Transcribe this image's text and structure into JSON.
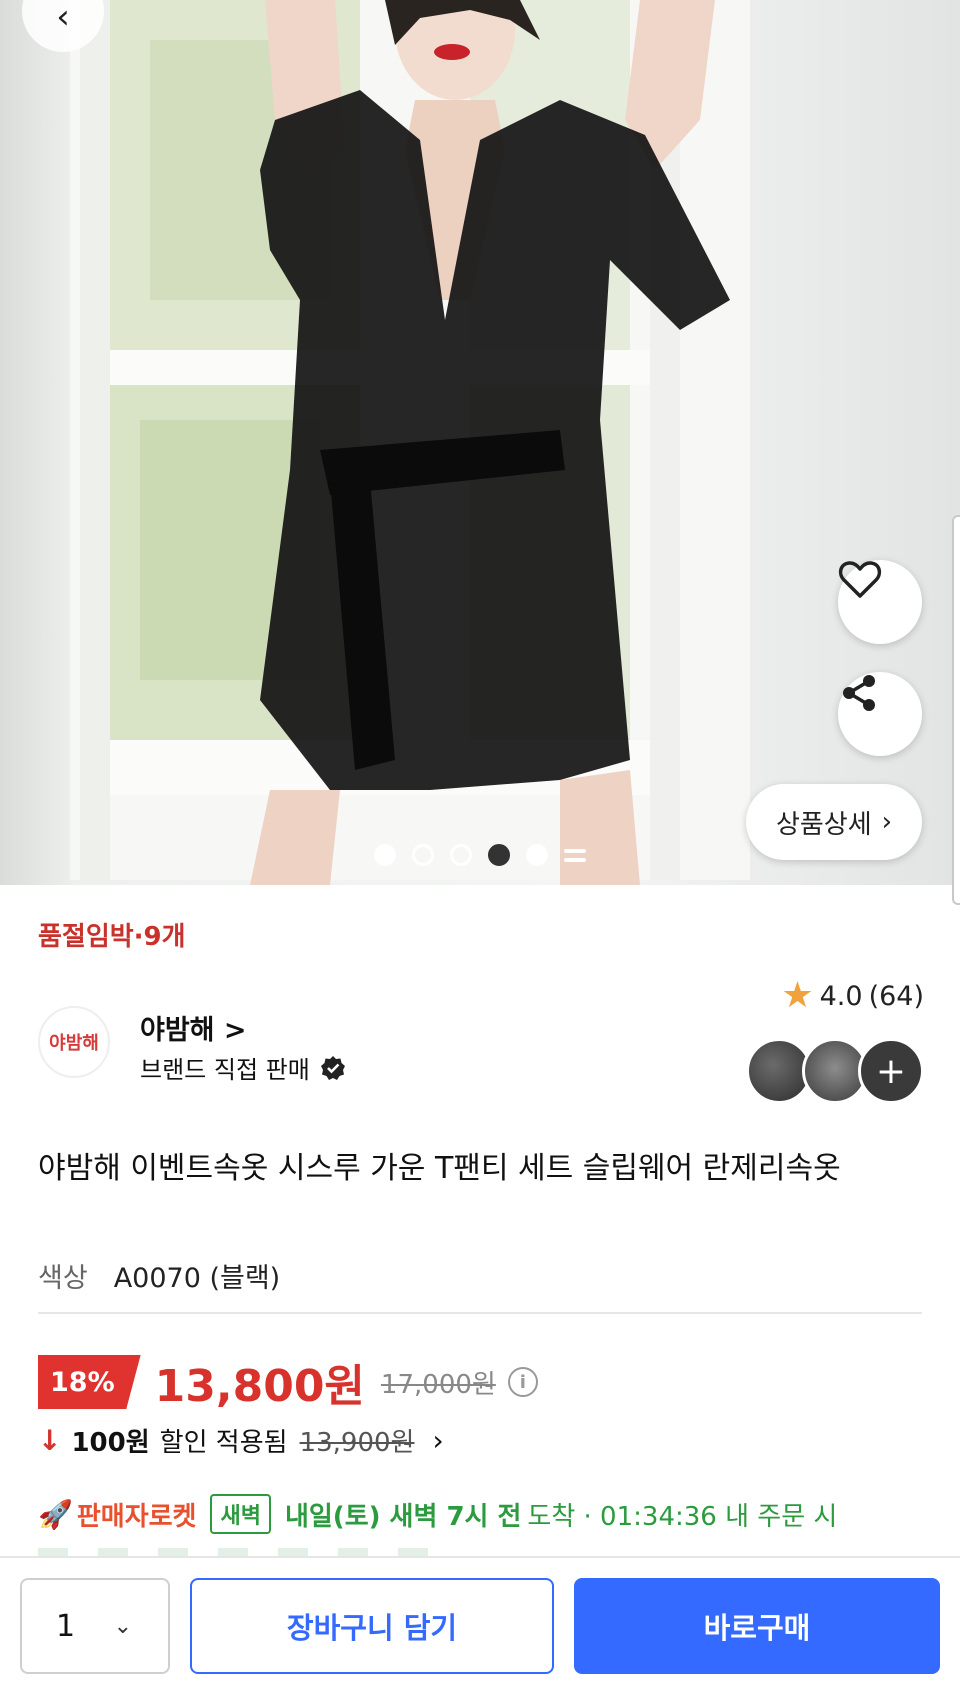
{
  "hero": {
    "back_icon": "chevron-left-icon",
    "heart_icon": "heart-outline-icon",
    "share_icon": "share-icon",
    "detail_label": "상품상세",
    "detail_chevron": "›",
    "dots_count": 5,
    "active_dot": 4
  },
  "stock": {
    "label": "품절임박·9개"
  },
  "seller": {
    "logo_text": "야밤해",
    "name": "야밤해 >",
    "subtitle": "브랜드 직접 판매"
  },
  "rating": {
    "score": "4.0",
    "count": "(64)"
  },
  "product": {
    "title": "야밤해 이벤트속옷 시스루 가운 T팬티 세트 슬립웨어 란제리속옷",
    "option_label": "색상",
    "option_value": "A0070 (블랙)"
  },
  "price": {
    "discount": "18%",
    "sale": "13,800원",
    "original": "17,000원",
    "coupon_amount": "100원",
    "coupon_text": "할인 적용됨",
    "coupon_original": "13,900원"
  },
  "delivery": {
    "label": "판매자로켓",
    "badge": "새벽",
    "arrive": "내일(토) 새벽 7시 전",
    "arrive_tail": "도착 · 01:34:36 내 주문 시"
  },
  "bottom": {
    "quantity": "1",
    "cart_label": "장바구니 담기",
    "buy_label": "바로구매"
  },
  "colors": {
    "accent_red": "#e0322e",
    "blue": "#346aff",
    "green": "#2c9a3f"
  }
}
